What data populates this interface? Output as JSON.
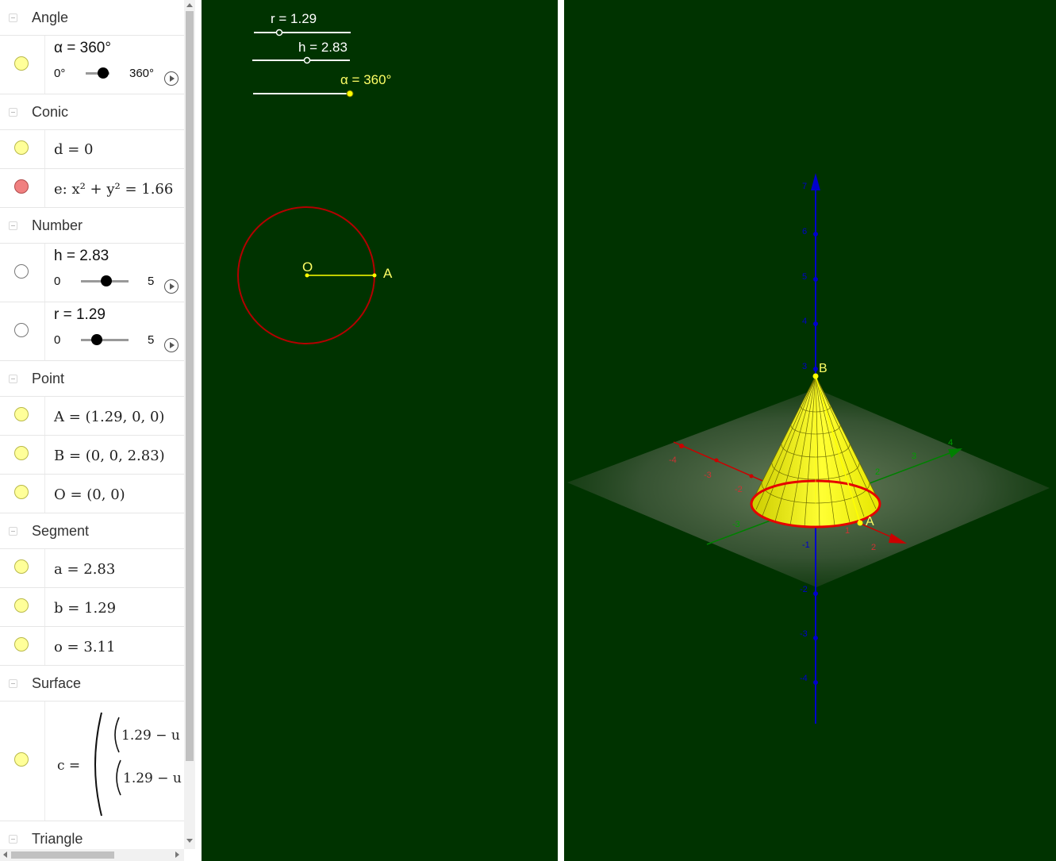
{
  "algebra": {
    "groups": {
      "angle": "Angle",
      "conic": "Conic",
      "number": "Number",
      "point": "Point",
      "segment": "Segment",
      "surface": "Surface",
      "triangle": "Triangle"
    },
    "alpha": {
      "label": "α = 360°",
      "min": "0°",
      "max": "360°",
      "value_fraction": 1.0
    },
    "d": "d = 0",
    "e": "e: x² + y² = 1.66",
    "h": {
      "label": "h = 2.83",
      "min": "0",
      "max": "5",
      "value": 2.83
    },
    "r": {
      "label": "r = 1.29",
      "min": "0",
      "max": "5",
      "value": 1.29
    },
    "A": "A = (1.29, 0, 0)",
    "B": "B = (0, 0, 2.83)",
    "O": "O = (0, 0)",
    "a": "a = 2.83",
    "b": "b = 1.29",
    "o": "o = 3.11",
    "c": {
      "lhs": "c =",
      "row1": "1.29 − u",
      "row2": "1.29 − u"
    }
  },
  "graphics2d": {
    "sliders": {
      "r": "r = 1.29",
      "h": "h = 2.83",
      "alpha": "α = 360°"
    },
    "labels": {
      "O": "O",
      "A": "A"
    }
  },
  "graphics3d": {
    "labels": {
      "B": "B",
      "A": "A"
    },
    "z_ticks": [
      "7",
      "6",
      "5",
      "4",
      "3",
      "-1",
      "-2",
      "-3",
      "-4"
    ],
    "x_ticks": [
      "-4",
      "-3",
      "-2",
      "1",
      "2"
    ],
    "y_ticks": [
      "2",
      "3",
      "4",
      "-3"
    ]
  },
  "colors": {
    "background": "#003300",
    "yellow": "#ffff00",
    "conic": "#b30000",
    "x_axis": "#cc0000",
    "y_axis": "#008000",
    "z_axis": "#0000cc"
  }
}
